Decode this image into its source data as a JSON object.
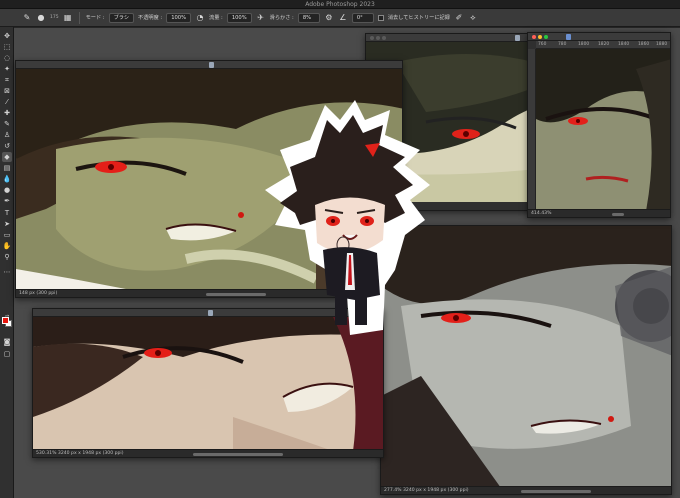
{
  "app": {
    "window_title": "Adobe Photoshop 2023"
  },
  "options_bar": {
    "brush_size": "175",
    "mode_label": "モード :",
    "mode_value": "ブラシ",
    "opacity_label": "不透明度 :",
    "opacity_value": "100%",
    "flow_label": "流量 :",
    "flow_value": "100%",
    "smoothing_label": "滑らかさ :",
    "smoothing_value": "8%",
    "angle_value": "0°",
    "erase_history_label": "消去してヒストリーに記録"
  },
  "colors": {
    "foreground": "#e8170f",
    "background": "#ffffff",
    "accent_red": "#ff5f57",
    "accent_yellow": "#febc2e",
    "accent_green": "#28c840"
  },
  "documents": [
    {
      "id": "doc-top-left",
      "status": "148 px (300 ppi)"
    },
    {
      "id": "doc-top-right-back",
      "status": ""
    },
    {
      "id": "doc-small-ruler",
      "status": "414.43%",
      "ruler_ticks": [
        "760",
        "780",
        "1800",
        "1820",
        "1840",
        "1860",
        "1880"
      ]
    },
    {
      "id": "doc-bottom-left",
      "status": "530.31%     3240 px x 1948 px (300 ppi)"
    },
    {
      "id": "doc-bottom-right",
      "status": "277.4%     3240 px x 1948 px (300 ppi)"
    }
  ],
  "toolbar": {
    "tools": [
      "move-tool",
      "marquee-tool",
      "lasso-tool",
      "magic-wand-tool",
      "crop-tool",
      "frame-tool",
      "eyedropper-tool",
      "healing-tool",
      "brush-tool",
      "stamp-tool",
      "history-brush-tool",
      "eraser-tool",
      "gradient-tool",
      "blur-tool",
      "dodge-tool",
      "pen-tool",
      "type-tool",
      "path-select-tool",
      "shape-tool",
      "hand-tool",
      "zoom-tool"
    ]
  }
}
